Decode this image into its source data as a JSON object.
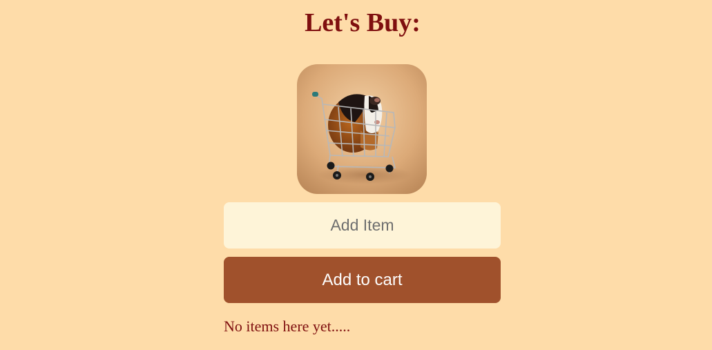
{
  "header": {
    "title": "Let's Buy:"
  },
  "hero": {
    "image_subject": "guinea-pig-in-shopping-cart"
  },
  "form": {
    "item_placeholder": "Add Item",
    "item_value": "",
    "submit_label": "Add to cart"
  },
  "cart": {
    "empty_message": "No items here yet....."
  },
  "colors": {
    "background": "#fedca9",
    "title": "#7f0f0f",
    "input_background": "#fef4d8",
    "button_background": "#a0512c",
    "button_text": "#fdfdfd"
  }
}
